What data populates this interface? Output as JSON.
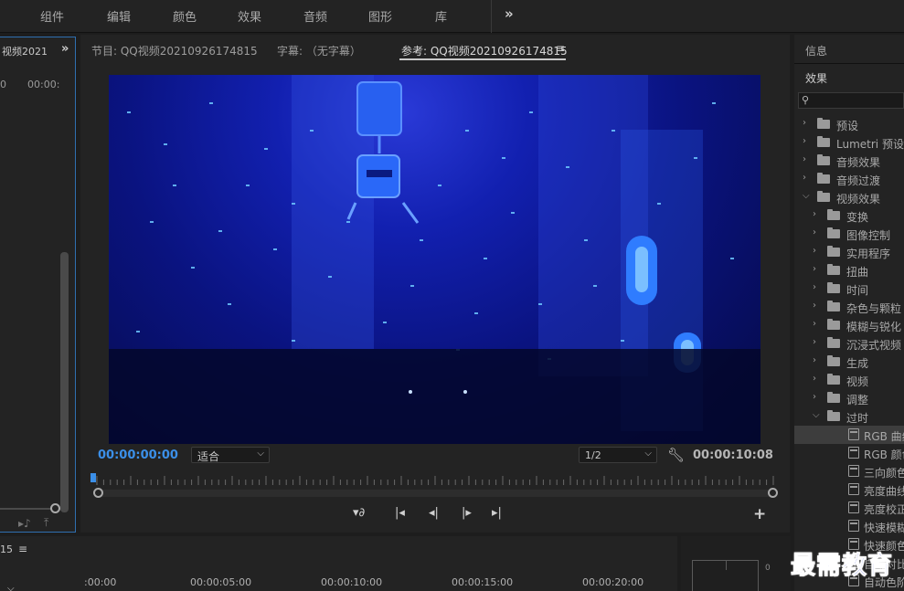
{
  "workspace_tabs": [
    "组件",
    "编辑",
    "颜色",
    "效果",
    "音频",
    "图形",
    "库"
  ],
  "left_panel": {
    "tab_label": "视频2021",
    "timecodes": [
      "0",
      "00:00:"
    ]
  },
  "monitor": {
    "tabs": [
      "节目: QQ视频20210926174815",
      "字幕: （无字幕）",
      "参考: QQ视频20210926174815"
    ],
    "active_tab_index": 2,
    "current_time": "00:00:00:00",
    "fit_value": "适合",
    "resolution_value": "1/2",
    "duration": "00:00:10:08",
    "playhead_progress": 0.0
  },
  "right_panel": {
    "info_label": "信息",
    "effects_label": "效果",
    "search_placeholder": "",
    "tree": [
      {
        "label": "预设",
        "level": 0,
        "expanded": false,
        "type": "folder-star"
      },
      {
        "label": "Lumetri 预设",
        "level": 0,
        "expanded": false,
        "type": "folder-star"
      },
      {
        "label": "音频效果",
        "level": 0,
        "expanded": false,
        "type": "folder"
      },
      {
        "label": "音频过渡",
        "level": 0,
        "expanded": false,
        "type": "folder"
      },
      {
        "label": "视频效果",
        "level": 0,
        "expanded": true,
        "type": "folder"
      },
      {
        "label": "变换",
        "level": 1,
        "expanded": false,
        "type": "folder"
      },
      {
        "label": "图像控制",
        "level": 1,
        "expanded": false,
        "type": "folder"
      },
      {
        "label": "实用程序",
        "level": 1,
        "expanded": false,
        "type": "folder"
      },
      {
        "label": "扭曲",
        "level": 1,
        "expanded": false,
        "type": "folder"
      },
      {
        "label": "时间",
        "level": 1,
        "expanded": false,
        "type": "folder"
      },
      {
        "label": "杂色与颗粒",
        "level": 1,
        "expanded": false,
        "type": "folder"
      },
      {
        "label": "模糊与锐化",
        "level": 1,
        "expanded": false,
        "type": "folder"
      },
      {
        "label": "沉浸式视频",
        "level": 1,
        "expanded": false,
        "type": "folder"
      },
      {
        "label": "生成",
        "level": 1,
        "expanded": false,
        "type": "folder"
      },
      {
        "label": "视频",
        "level": 1,
        "expanded": false,
        "type": "folder"
      },
      {
        "label": "调整",
        "level": 1,
        "expanded": false,
        "type": "folder"
      },
      {
        "label": "过时",
        "level": 1,
        "expanded": true,
        "type": "folder"
      },
      {
        "label": "RGB 曲线",
        "level": 2,
        "expanded": false,
        "type": "effect",
        "selected": true
      },
      {
        "label": "RGB 颜色校正器",
        "level": 2,
        "expanded": false,
        "type": "effect"
      },
      {
        "label": "三向颜色校正器",
        "level": 2,
        "expanded": false,
        "type": "effect"
      },
      {
        "label": "亮度曲线",
        "level": 2,
        "expanded": false,
        "type": "effect"
      },
      {
        "label": "亮度校正器",
        "level": 2,
        "expanded": false,
        "type": "effect"
      },
      {
        "label": "快速模糊",
        "level": 2,
        "expanded": false,
        "type": "effect"
      },
      {
        "label": "快速颜色校正器",
        "level": 2,
        "expanded": false,
        "type": "effect"
      },
      {
        "label": "自动对比度",
        "level": 2,
        "expanded": false,
        "type": "effect"
      },
      {
        "label": "自动色阶",
        "level": 2,
        "expanded": false,
        "type": "effect"
      }
    ]
  },
  "timeline": {
    "sequence_tc": "15",
    "ruler_marks": [
      ":00:00",
      "00:00:05:00",
      "00:00:10:00",
      "00:00:15:00",
      "00:00:20:00"
    ]
  },
  "meter": {
    "zero_label": "0"
  },
  "watermark": "最需教育",
  "icons": {
    "more": "chevron-double-right-icon",
    "menu": "hamburger-menu-icon",
    "wrench": "wrench-icon",
    "add": "plus-icon",
    "search": "search-icon"
  },
  "colors": {
    "accent_blue": "#3b8fe8",
    "panel_bg": "#232323",
    "watermark_blue": "#1a2fd8"
  }
}
